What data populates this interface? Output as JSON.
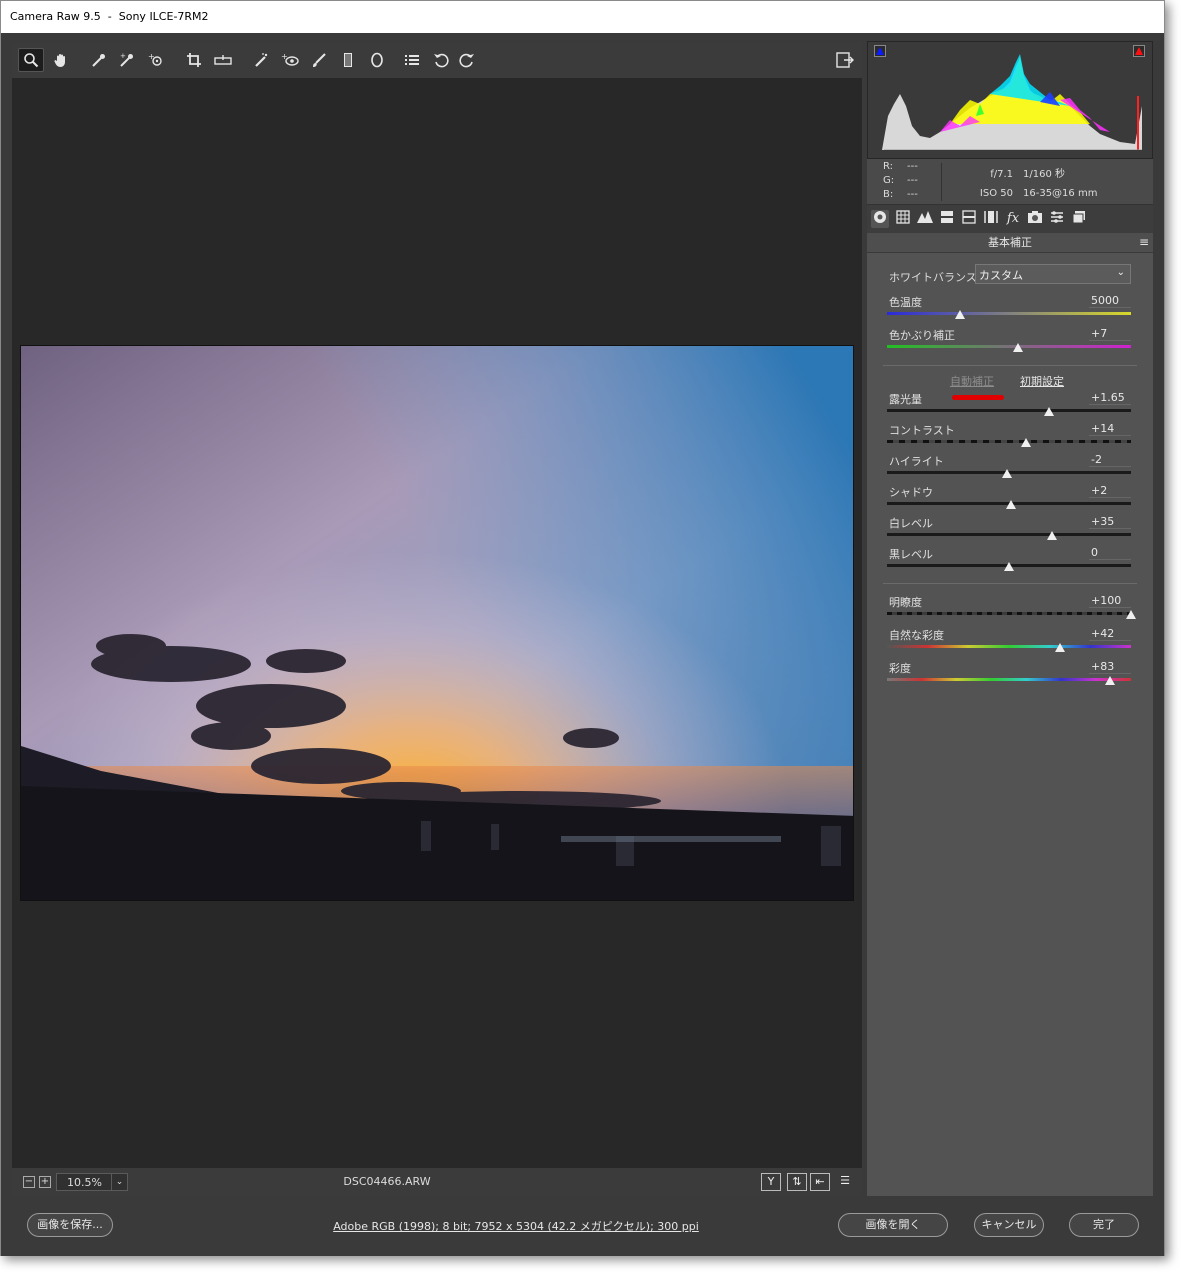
{
  "window": {
    "title": "Camera Raw 9.5  -  Sony ILCE-7RM2"
  },
  "toolbar": {
    "tools": [
      {
        "name": "zoom-tool",
        "icon": "magnifier-icon",
        "glyph": "🔍"
      },
      {
        "name": "hand-tool",
        "icon": "hand-icon",
        "glyph": "✋"
      },
      {
        "name": "white-balance-tool",
        "icon": "eyedropper-icon",
        "glyph": "⟋"
      },
      {
        "name": "color-sampler-tool",
        "icon": "color-sampler-icon",
        "glyph": "⟋"
      },
      {
        "name": "targeted-adjustment-tool",
        "icon": "targeted-adjustment-icon",
        "glyph": "⊙"
      },
      {
        "name": "crop-tool",
        "icon": "crop-icon",
        "glyph": "⌗"
      },
      {
        "name": "straighten-tool",
        "icon": "level-icon",
        "glyph": "⌓"
      },
      {
        "name": "spot-removal-tool",
        "icon": "spot-removal-icon",
        "glyph": "⟋"
      },
      {
        "name": "red-eye-tool",
        "icon": "red-eye-icon",
        "glyph": "👁"
      },
      {
        "name": "adjustment-brush-tool",
        "icon": "brush-icon",
        "glyph": "🖌"
      },
      {
        "name": "graduated-filter-tool",
        "icon": "graduated-filter-icon",
        "glyph": "▮"
      },
      {
        "name": "radial-filter-tool",
        "icon": "radial-filter-icon",
        "glyph": "◯"
      },
      {
        "name": "preferences-tool",
        "icon": "list-icon",
        "glyph": "☰"
      },
      {
        "name": "rotate-left-tool",
        "icon": "rotate-ccw-icon",
        "glyph": "↺"
      },
      {
        "name": "rotate-right-tool",
        "icon": "rotate-cw-icon",
        "glyph": "↻"
      }
    ],
    "fullscreen_icon": "⇲"
  },
  "status": {
    "zoom_out": "−",
    "zoom_in": "+",
    "zoom": "10.5%",
    "filename": "DSC04466.ARW",
    "view_buttons": [
      "Y",
      "⇅",
      "⇤",
      "☰"
    ]
  },
  "histogram": {
    "shadow_clip_color": "#0000ff",
    "highlight_clip_color": "#ff0000"
  },
  "readout": {
    "r_label": "R:",
    "r_value": "---",
    "g_label": "G:",
    "g_value": "---",
    "b_label": "B:",
    "b_value": "---",
    "aperture": "f/7.1",
    "shutter": "1/160 秒",
    "iso": "ISO 50",
    "lens": "16-35@16 mm"
  },
  "panel": {
    "title": "基本補正",
    "tabs": [
      "◉",
      "▦",
      "▲",
      "▤",
      "▥",
      "◫",
      "fx",
      "◙",
      "≡",
      "▣"
    ],
    "white_balance_label": "ホワイトバランス :",
    "white_balance_value": "カスタム",
    "auto_label": "自動補正",
    "default_label": "初期設定",
    "sliders": [
      {
        "id": "temp",
        "label": "色温度",
        "value": "5000",
        "position": 0.3
      },
      {
        "id": "tint",
        "label": "色かぶり補正",
        "value": "+7",
        "position": 0.535
      },
      {
        "id": "exposure",
        "label": "露光量",
        "value": "+1.65",
        "position": 0.665
      },
      {
        "id": "contrast",
        "label": "コントラスト",
        "value": "+14",
        "position": 0.57
      },
      {
        "id": "highlights",
        "label": "ハイライト",
        "value": "-2",
        "position": 0.49
      },
      {
        "id": "shadows",
        "label": "シャドウ",
        "value": "+2",
        "position": 0.51
      },
      {
        "id": "whites",
        "label": "白レベル",
        "value": "+35",
        "position": 0.675
      },
      {
        "id": "blacks",
        "label": "黒レベル",
        "value": "0",
        "position": 0.5
      },
      {
        "id": "clarity",
        "label": "明瞭度",
        "value": "+100",
        "position": 1.0
      },
      {
        "id": "vibrance",
        "label": "自然な彩度",
        "value": "+42",
        "position": 0.71
      },
      {
        "id": "saturation",
        "label": "彩度",
        "value": "+83",
        "position": 0.915
      }
    ]
  },
  "footer": {
    "save_label": "画像を保存...",
    "workflow_info": "Adobe RGB (1998); 8 bit; 7952 x 5304 (42.2 メガピクセル); 300 ppi",
    "open_label": "画像を開く",
    "cancel_label": "キャンセル",
    "done_label": "完了"
  }
}
